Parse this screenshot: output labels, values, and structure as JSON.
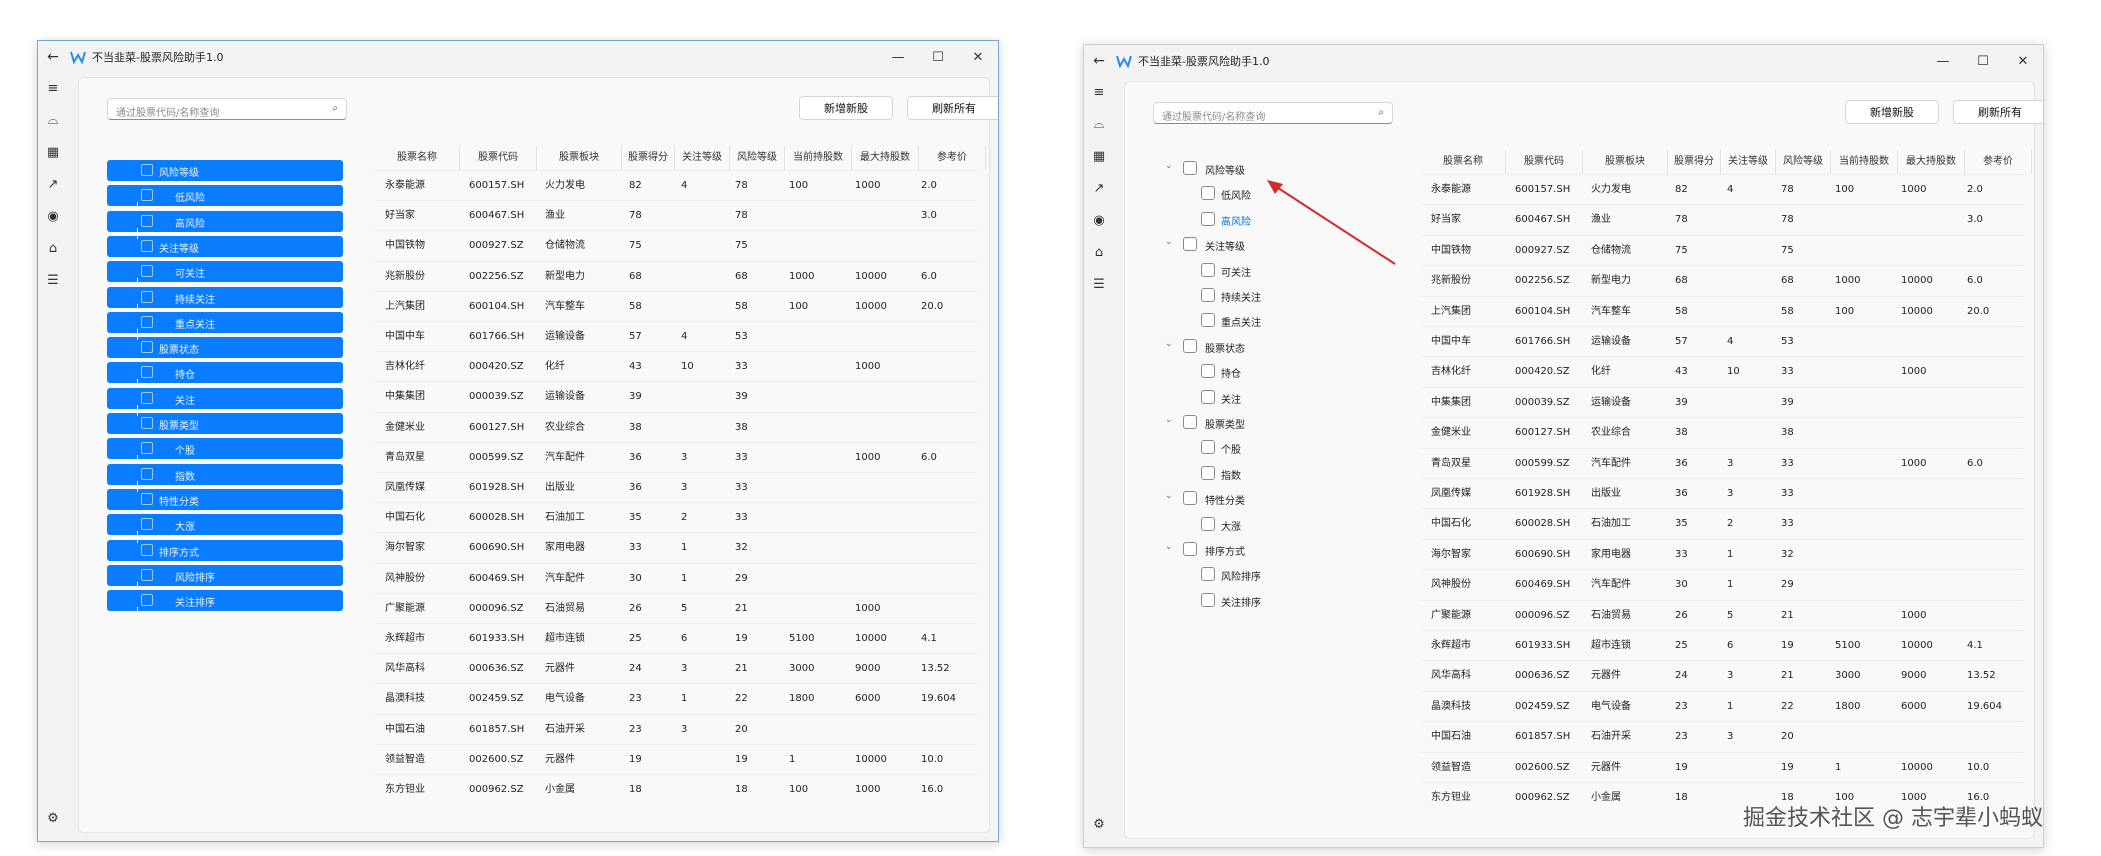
{
  "app": {
    "title": "不当韭菜-股票风险助手1.0"
  },
  "search": {
    "placeholder": "通过股票代码/名称查询"
  },
  "toolbar": {
    "add_label": "新增新股",
    "refresh_label": "刷新所有"
  },
  "tree": [
    {
      "label": "风险等级",
      "children": [
        "低风险",
        "高风险"
      ]
    },
    {
      "label": "关注等级",
      "children": [
        "可关注",
        "持续关注",
        "重点关注"
      ]
    },
    {
      "label": "股票状态",
      "children": [
        "持仓",
        "关注"
      ]
    },
    {
      "label": "股票类型",
      "children": [
        "个股",
        "指数"
      ]
    },
    {
      "label": "特性分类",
      "children": [
        "大涨"
      ]
    },
    {
      "label": "排序方式",
      "children": [
        "风险排序",
        "关注排序"
      ]
    }
  ],
  "table": {
    "columns": [
      "股票名称",
      "股票代码",
      "股票板块",
      "股票得分",
      "关注等级",
      "风险等级",
      "当前持股数",
      "最大持股数",
      "参考价"
    ],
    "rows": [
      [
        "永泰能源",
        "600157.SH",
        "火力发电",
        "82",
        "4",
        "78",
        "100",
        "1000",
        "2.0"
      ],
      [
        "好当家",
        "600467.SH",
        "渔业",
        "78",
        "",
        "78",
        "",
        "",
        "3.0"
      ],
      [
        "中国铁物",
        "000927.SZ",
        "仓储物流",
        "75",
        "",
        "75",
        "",
        "",
        ""
      ],
      [
        "兆新股份",
        "002256.SZ",
        "新型电力",
        "68",
        "",
        "68",
        "1000",
        "10000",
        "6.0"
      ],
      [
        "上汽集团",
        "600104.SH",
        "汽车整车",
        "58",
        "",
        "58",
        "100",
        "10000",
        "20.0"
      ],
      [
        "中国中车",
        "601766.SH",
        "运输设备",
        "57",
        "4",
        "53",
        "",
        "",
        ""
      ],
      [
        "吉林化纤",
        "000420.SZ",
        "化纤",
        "43",
        "10",
        "33",
        "",
        "1000",
        ""
      ],
      [
        "中集集团",
        "000039.SZ",
        "运输设备",
        "39",
        "",
        "39",
        "",
        "",
        ""
      ],
      [
        "金健米业",
        "600127.SH",
        "农业综合",
        "38",
        "",
        "38",
        "",
        "",
        ""
      ],
      [
        "青岛双星",
        "000599.SZ",
        "汽车配件",
        "36",
        "3",
        "33",
        "",
        "1000",
        "6.0"
      ],
      [
        "凤凰传媒",
        "601928.SH",
        "出版业",
        "36",
        "3",
        "33",
        "",
        "",
        ""
      ],
      [
        "中国石化",
        "600028.SH",
        "石油加工",
        "35",
        "2",
        "33",
        "",
        "",
        ""
      ],
      [
        "海尔智家",
        "600690.SH",
        "家用电器",
        "33",
        "1",
        "32",
        "",
        "",
        ""
      ],
      [
        "风神股份",
        "600469.SH",
        "汽车配件",
        "30",
        "1",
        "29",
        "",
        "",
        ""
      ],
      [
        "广聚能源",
        "000096.SZ",
        "石油贸易",
        "26",
        "5",
        "21",
        "",
        "1000",
        ""
      ],
      [
        "永辉超市",
        "601933.SH",
        "超市连锁",
        "25",
        "6",
        "19",
        "5100",
        "10000",
        "4.1"
      ],
      [
        "风华高科",
        "000636.SZ",
        "元器件",
        "24",
        "3",
        "21",
        "3000",
        "9000",
        "13.52"
      ],
      [
        "晶澳科技",
        "002459.SZ",
        "电气设备",
        "23",
        "1",
        "22",
        "1800",
        "6000",
        "19.604"
      ],
      [
        "中国石油",
        "601857.SH",
        "石油开采",
        "23",
        "3",
        "20",
        "",
        "",
        ""
      ],
      [
        "领益智造",
        "002600.SZ",
        "元器件",
        "19",
        "",
        "19",
        "1",
        "10000",
        "10.0"
      ],
      [
        "东方钽业",
        "000962.SZ",
        "小金属",
        "18",
        "",
        "18",
        "100",
        "1000",
        "16.0"
      ]
    ]
  },
  "watermark": "掘金技术社区 @ 志宇辈小蚂蚁",
  "colors": {
    "accent": "#0a7cff",
    "arrow": "#d42a2a"
  }
}
